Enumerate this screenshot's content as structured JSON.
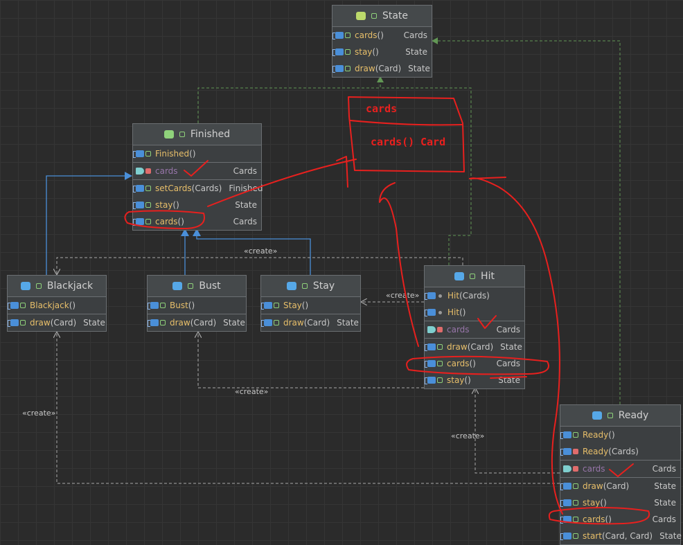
{
  "create_label": "«create»",
  "nodes": {
    "state": {
      "title": "State",
      "rows": [
        {
          "name": "cards",
          "args": "()",
          "type": "Cards"
        },
        {
          "name": "stay",
          "args": "()",
          "type": "State"
        },
        {
          "name": "draw",
          "args": "(Card)",
          "type": "State"
        }
      ]
    },
    "finished": {
      "title": "Finished",
      "rows": [
        {
          "name": "Finished",
          "args": " ()",
          "type": ""
        },
        {
          "name": "cards",
          "args": "",
          "type": "Cards"
        },
        {
          "name": "setCards",
          "args": " (Cards)",
          "type": "Finished"
        },
        {
          "name": "stay",
          "args": "()",
          "type": "State"
        },
        {
          "name": "cards",
          "args": "()",
          "type": "Cards"
        }
      ]
    },
    "blackjack": {
      "title": "Blackjack",
      "rows": [
        {
          "name": "Blackjack",
          "args": " ()",
          "type": ""
        },
        {
          "name": "draw",
          "args": "(Card)",
          "type": "State"
        }
      ]
    },
    "bust": {
      "title": "Bust",
      "rows": [
        {
          "name": "Bust",
          "args": "()",
          "type": ""
        },
        {
          "name": "draw",
          "args": "(Card)",
          "type": "State"
        }
      ]
    },
    "stay": {
      "title": "Stay",
      "rows": [
        {
          "name": "Stay",
          "args": "()",
          "type": ""
        },
        {
          "name": "draw",
          "args": "(Card)",
          "type": "State"
        }
      ]
    },
    "hit": {
      "title": "Hit",
      "rows": [
        {
          "name": "Hit",
          "args": "(Cards)",
          "type": ""
        },
        {
          "name": "Hit",
          "args": "()",
          "type": ""
        },
        {
          "name": "cards",
          "args": "",
          "type": "Cards"
        },
        {
          "name": "draw",
          "args": "(Card)",
          "type": "State"
        },
        {
          "name": "cards",
          "args": "()",
          "type": "Cards"
        },
        {
          "name": "stay",
          "args": "()",
          "type": "State"
        }
      ]
    },
    "ready": {
      "title": "Ready",
      "rows": [
        {
          "name": "Ready",
          "args": " ()",
          "type": ""
        },
        {
          "name": "Ready",
          "args": " (Cards)",
          "type": ""
        },
        {
          "name": "cards",
          "args": "",
          "type": "Cards"
        },
        {
          "name": "draw",
          "args": "(Card)",
          "type": "State"
        },
        {
          "name": "stay",
          "args": "()",
          "type": "State"
        },
        {
          "name": "cards",
          "args": "()",
          "type": "Cards"
        },
        {
          "name": "start",
          "args": "(Card, Card)",
          "type": "State"
        }
      ]
    }
  },
  "annotations": {
    "field_label": "cards",
    "method_label": "cards()",
    "type_label": "Card"
  },
  "colors": {
    "implements_edge": "#629755",
    "extends_edge": "#4a8fd9",
    "create_edge": "#a9a9a9",
    "annotation": "#e8201e"
  }
}
